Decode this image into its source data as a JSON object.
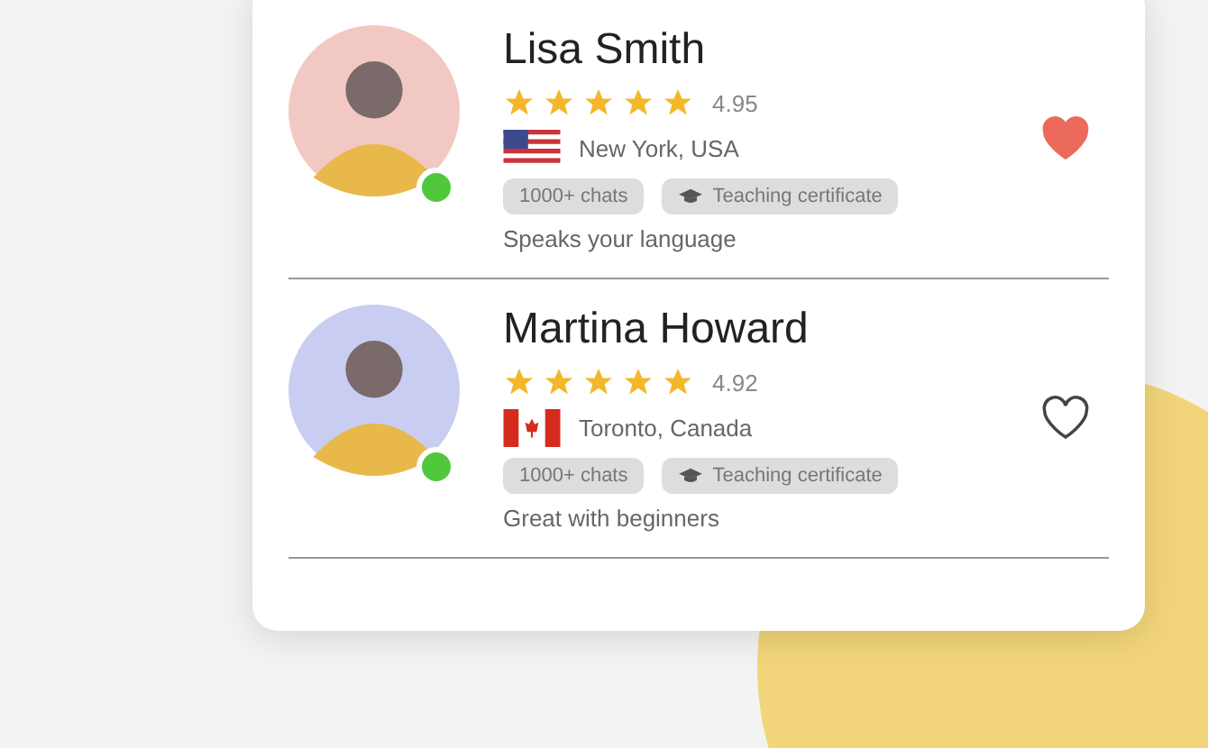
{
  "tutors": [
    {
      "name": "Lisa Smith",
      "stars": 5,
      "rating": "4.95",
      "flag": {
        "kind": "us"
      },
      "location": "New York, USA",
      "online": true,
      "favorite": true,
      "color": "#f2c9c2",
      "tags": [
        {
          "kind": "count",
          "label": "1000+ chats"
        },
        {
          "kind": "certificate",
          "label": "Teaching certificate"
        }
      ],
      "note": "Speaks your language"
    },
    {
      "name": "Martina Howard",
      "stars": 5,
      "rating": "4.92",
      "flag": {
        "kind": "ca"
      },
      "location": "Toronto, Canada",
      "online": true,
      "favorite": false,
      "color": "#c9cdf2",
      "tags": [
        {
          "kind": "count",
          "label": "1000+ chats"
        },
        {
          "kind": "certificate",
          "label": "Teaching certificate"
        }
      ],
      "note": "Great with beginners"
    }
  ]
}
